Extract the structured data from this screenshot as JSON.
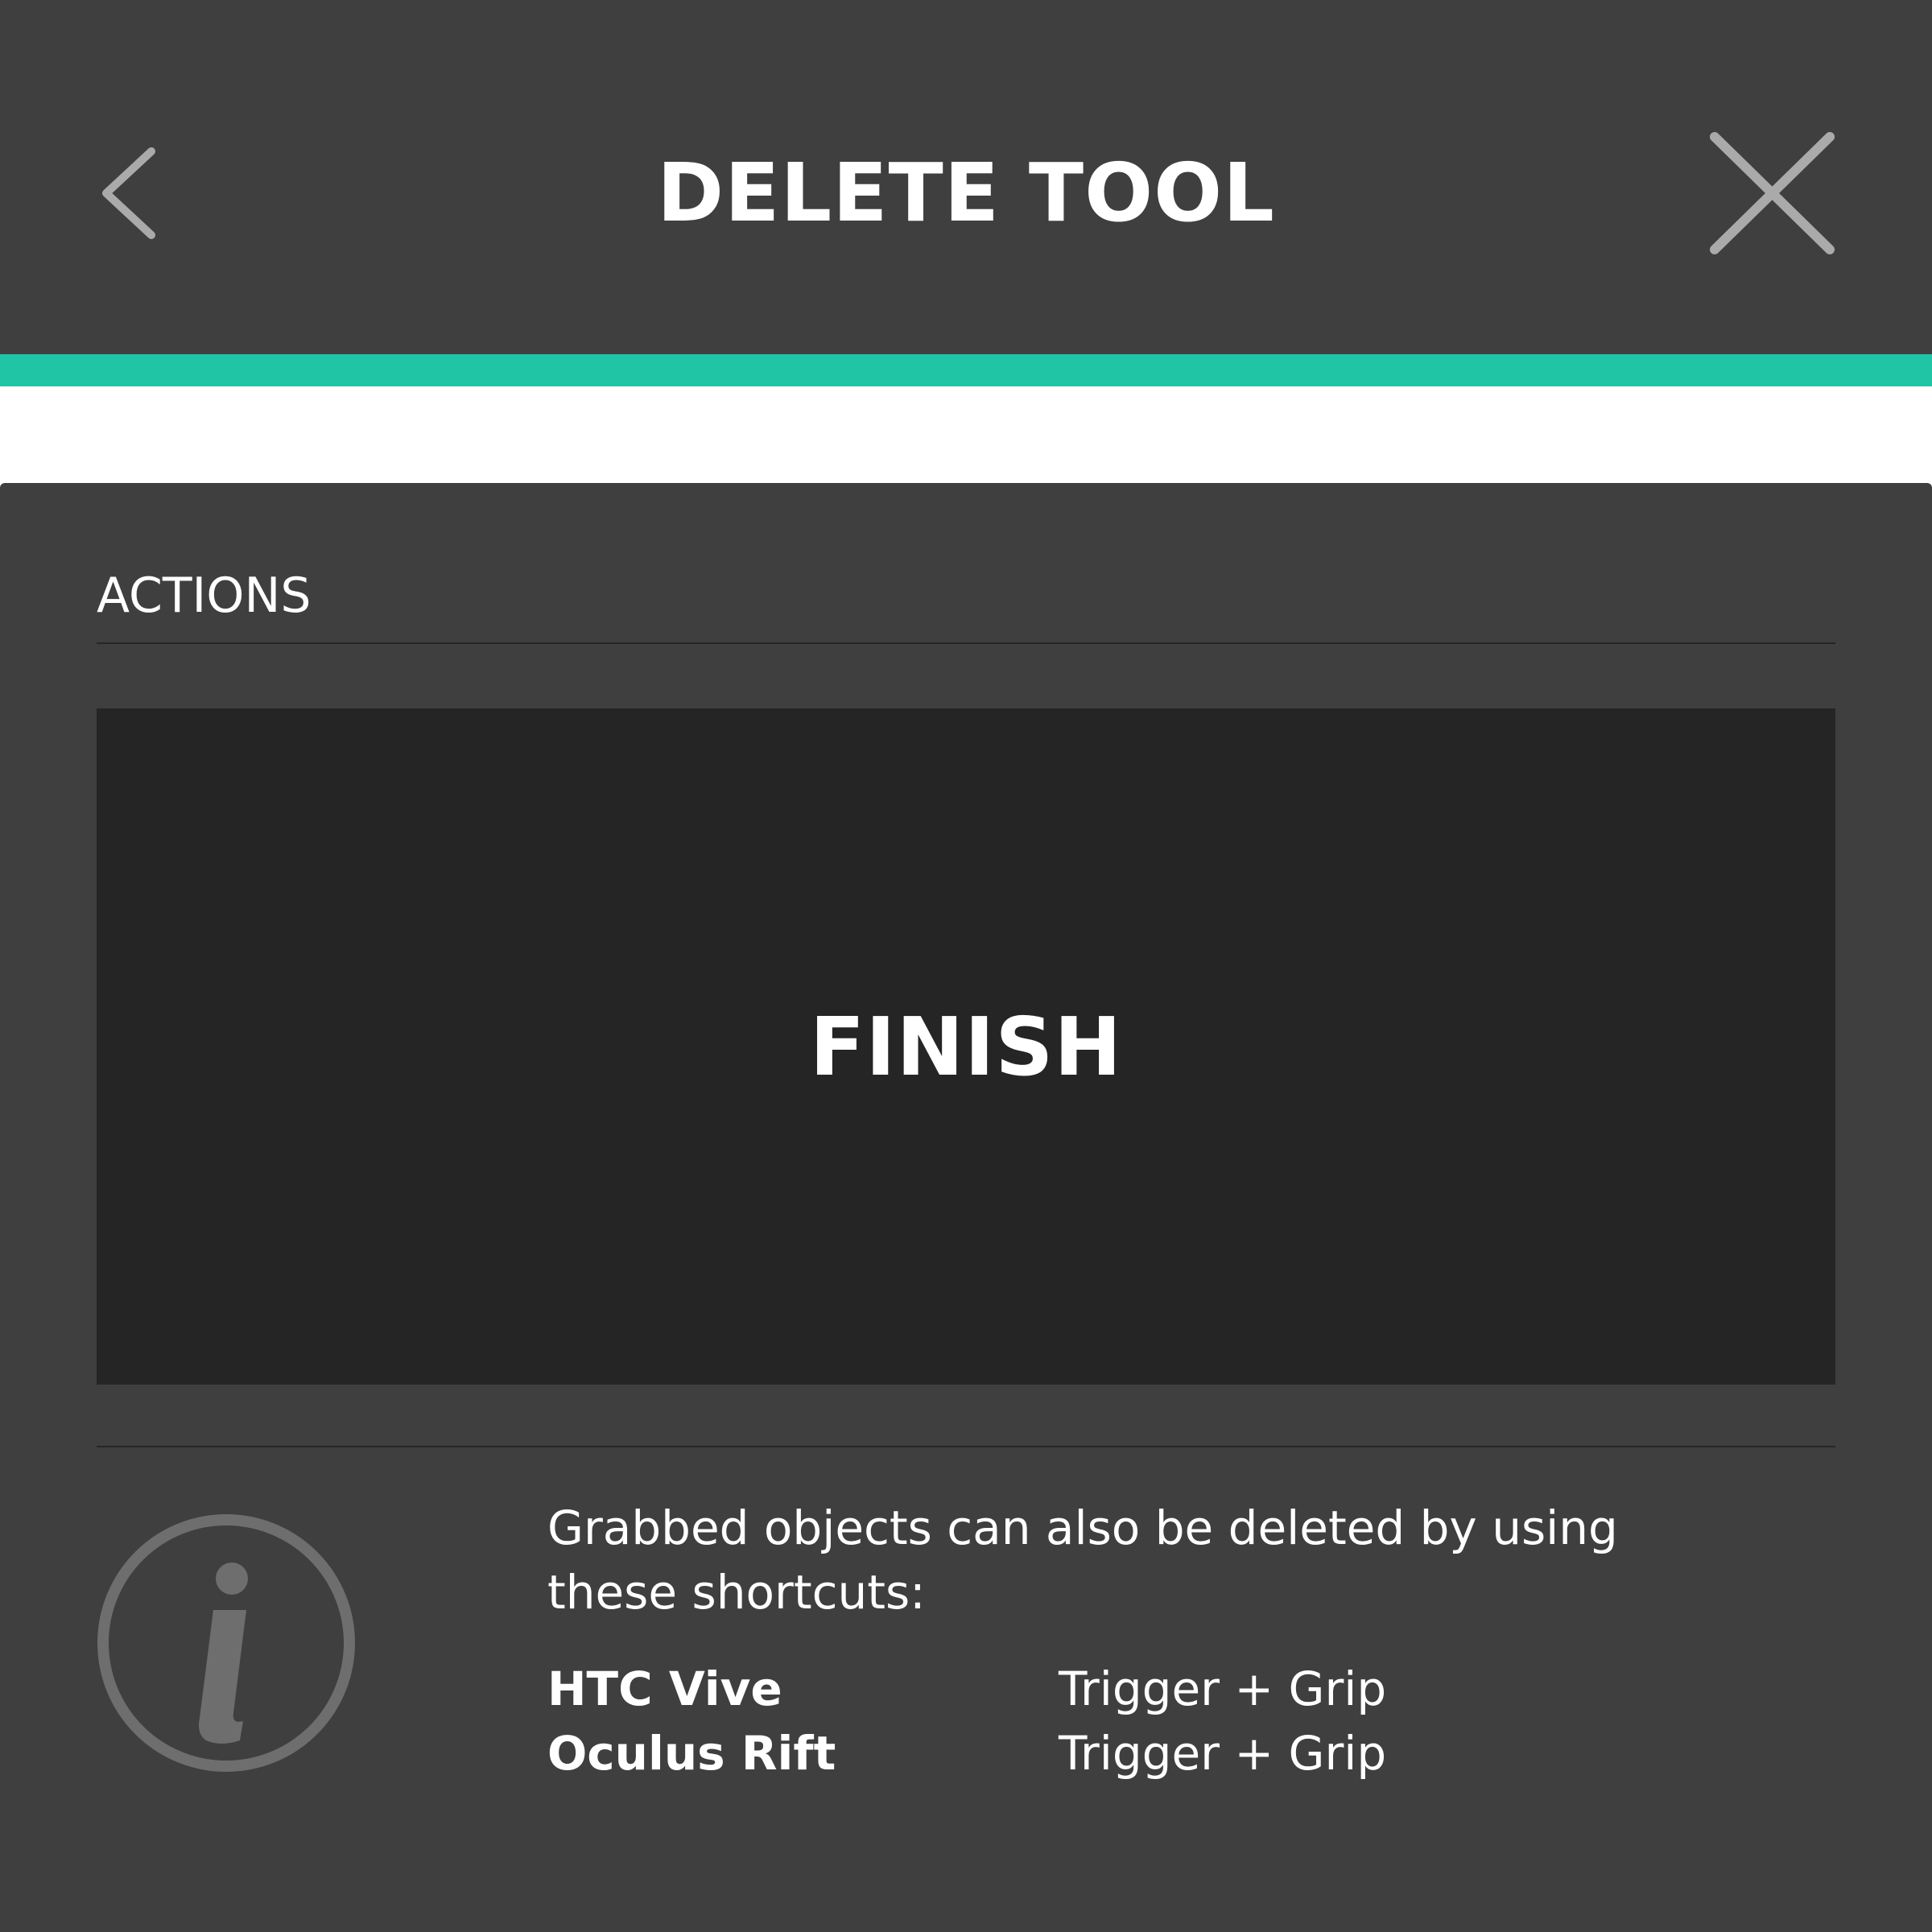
{
  "colors": {
    "background": "#3f3f3f",
    "accent": "#1fc5a5",
    "button_bg": "#252525",
    "icon_gray": "#aaaaaa",
    "info_icon_gray": "#6e6e6e",
    "text": "#ffffff"
  },
  "header": {
    "title": "DELETE TOOL",
    "back_icon": "chevron-left-icon",
    "close_icon": "close-icon"
  },
  "actions": {
    "section_label": "ACTIONS",
    "finish_label": "FINISH"
  },
  "info": {
    "icon": "info-icon",
    "description": "Grabbed objects can also be deleted by using these shortcuts:",
    "shortcuts": [
      {
        "device": "HTC Vive",
        "combo": "Trigger + Grip"
      },
      {
        "device": "Oculus Rift",
        "combo": "Trigger + Grip"
      }
    ]
  }
}
